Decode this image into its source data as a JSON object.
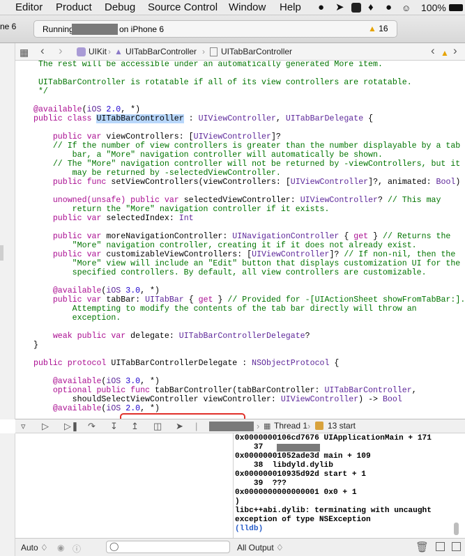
{
  "menubar": {
    "items": [
      "Editor",
      "Product",
      "Debug",
      "Source Control",
      "Window",
      "Help"
    ],
    "battery": "100%",
    "status_icons": [
      "qq-icon",
      "send-icon",
      "app-icon",
      "evernote-icon",
      "skype-icon",
      "menu-extra-icon",
      "wifi-icon",
      "battery-icon"
    ]
  },
  "toolbar": {
    "scheme_fragment": "ne 6",
    "status_running": "Running",
    "status_device": "on iPhone 6",
    "warning_count": "16"
  },
  "jumpbar": {
    "crumbs": [
      "UIKit",
      "UITabBarController",
      "UITabBarController"
    ]
  },
  "colors": {
    "keyword": "#aa0d91",
    "type": "#5c2699",
    "comment": "#007400",
    "number": "#1c00cf",
    "selection": "#b8d7fb",
    "callout": "#e0302a"
  },
  "code": {
    "lines": [
      [
        {
          "t": " The rest will be accessible under an automatically generated More item.",
          "c": "cm"
        }
      ],
      [],
      [
        {
          "t": " UITabBarController is rotatable if all of its view controllers are rotatable.",
          "c": "cm"
        }
      ],
      [
        {
          "t": " */",
          "c": "cm"
        }
      ],
      [],
      [
        {
          "t": "@available",
          "c": "kw"
        },
        {
          "t": "("
        },
        {
          "t": "iOS",
          "c": "ty"
        },
        {
          "t": " "
        },
        {
          "t": "2.0",
          "c": "nu"
        },
        {
          "t": ", *)"
        }
      ],
      [
        {
          "t": "public",
          "c": "kw"
        },
        {
          "t": " "
        },
        {
          "t": "class",
          "c": "kw"
        },
        {
          "t": " "
        },
        {
          "t": "UITabBarController",
          "c": "hl"
        },
        {
          "t": " : "
        },
        {
          "t": "UIViewController",
          "c": "ty"
        },
        {
          "t": ", "
        },
        {
          "t": "UITabBarDelegate",
          "c": "ty"
        },
        {
          "t": " {"
        }
      ],
      [],
      [
        {
          "t": "    "
        },
        {
          "t": "public",
          "c": "kw"
        },
        {
          "t": " "
        },
        {
          "t": "var",
          "c": "kw"
        },
        {
          "t": " viewControllers: ["
        },
        {
          "t": "UIViewController",
          "c": "ty"
        },
        {
          "t": "]?"
        }
      ],
      [
        {
          "t": "    // If the number of view controllers is greater than the number displayable by a tab",
          "c": "cm"
        }
      ],
      [
        {
          "t": "        bar, a \"More\" navigation controller will automatically be shown.",
          "c": "cm"
        }
      ],
      [
        {
          "t": "    // The \"More\" navigation controller will not be returned by -viewControllers, but it",
          "c": "cm"
        }
      ],
      [
        {
          "t": "        may be returned by -selectedViewController.",
          "c": "cm"
        }
      ],
      [
        {
          "t": "    "
        },
        {
          "t": "public",
          "c": "kw"
        },
        {
          "t": " "
        },
        {
          "t": "func",
          "c": "kw"
        },
        {
          "t": " setViewControllers(viewControllers: ["
        },
        {
          "t": "UIViewController",
          "c": "ty"
        },
        {
          "t": "]?, animated: "
        },
        {
          "t": "Bool",
          "c": "ty"
        },
        {
          "t": ")"
        }
      ],
      [],
      [
        {
          "t": "    "
        },
        {
          "t": "unowned(unsafe) public var",
          "c": "kw"
        },
        {
          "t": " selectedViewController: "
        },
        {
          "t": "UIViewController",
          "c": "ty"
        },
        {
          "t": "? "
        },
        {
          "t": "// This may",
          "c": "cm"
        }
      ],
      [
        {
          "t": "        return the \"More\" navigation controller if it exists.",
          "c": "cm"
        }
      ],
      [
        {
          "t": "    "
        },
        {
          "t": "public",
          "c": "kw"
        },
        {
          "t": " "
        },
        {
          "t": "var",
          "c": "kw"
        },
        {
          "t": " selectedIndex: "
        },
        {
          "t": "Int",
          "c": "ty"
        }
      ],
      [],
      [
        {
          "t": "    "
        },
        {
          "t": "public",
          "c": "kw"
        },
        {
          "t": " "
        },
        {
          "t": "var",
          "c": "kw"
        },
        {
          "t": " moreNavigationController: "
        },
        {
          "t": "UINavigationController",
          "c": "ty"
        },
        {
          "t": " { "
        },
        {
          "t": "get",
          "c": "kw"
        },
        {
          "t": " } "
        },
        {
          "t": "// Returns the",
          "c": "cm"
        }
      ],
      [
        {
          "t": "        \"More\" navigation controller, creating it if it does not already exist.",
          "c": "cm"
        }
      ],
      [
        {
          "t": "    "
        },
        {
          "t": "public",
          "c": "kw"
        },
        {
          "t": " "
        },
        {
          "t": "var",
          "c": "kw"
        },
        {
          "t": " customizableViewControllers: ["
        },
        {
          "t": "UIViewController",
          "c": "ty"
        },
        {
          "t": "]? "
        },
        {
          "t": "// If non-nil, then the",
          "c": "cm"
        }
      ],
      [
        {
          "t": "        \"More\" view will include an \"Edit\" button that displays customization UI for the",
          "c": "cm"
        }
      ],
      [
        {
          "t": "        specified controllers. By default, all view controllers are customizable.",
          "c": "cm"
        }
      ],
      [],
      [
        {
          "t": "    "
        },
        {
          "t": "@available",
          "c": "kw"
        },
        {
          "t": "("
        },
        {
          "t": "iOS",
          "c": "ty"
        },
        {
          "t": " "
        },
        {
          "t": "3.0",
          "c": "nu"
        },
        {
          "t": ", *)"
        }
      ],
      [
        {
          "t": "    "
        },
        {
          "t": "public",
          "c": "kw"
        },
        {
          "t": " "
        },
        {
          "t": "var",
          "c": "kw"
        },
        {
          "t": " tabBar: "
        },
        {
          "t": "UITabBar",
          "c": "ty"
        },
        {
          "t": " { "
        },
        {
          "t": "get",
          "c": "kw"
        },
        {
          "t": " } "
        },
        {
          "t": "// Provided for -[UIActionSheet showFromTabBar:].",
          "c": "cm"
        }
      ],
      [
        {
          "t": "        Attempting to modify the contents of the tab bar directly will throw an",
          "c": "cm"
        }
      ],
      [
        {
          "t": "        exception.",
          "c": "cm"
        }
      ],
      [],
      [
        {
          "t": "    "
        },
        {
          "t": "weak public var",
          "c": "kw"
        },
        {
          "t": " delegate: "
        },
        {
          "t": "UITabBarControllerDelegate",
          "c": "ty"
        },
        {
          "t": "?"
        }
      ],
      [
        {
          "t": "}"
        }
      ],
      [],
      [
        {
          "t": "public",
          "c": "kw"
        },
        {
          "t": " "
        },
        {
          "t": "protocol",
          "c": "kw"
        },
        {
          "t": " "
        },
        {
          "t": "UITabBarControllerDelegate"
        },
        {
          "t": " : "
        },
        {
          "t": "NSObjectProtocol",
          "c": "ty"
        },
        {
          "t": " {"
        }
      ],
      [],
      [
        {
          "t": "    "
        },
        {
          "t": "@available",
          "c": "kw"
        },
        {
          "t": "("
        },
        {
          "t": "iOS",
          "c": "ty"
        },
        {
          "t": " "
        },
        {
          "t": "3.0",
          "c": "nu"
        },
        {
          "t": ", *)"
        }
      ],
      [
        {
          "t": "    "
        },
        {
          "t": "optional public func",
          "c": "kw"
        },
        {
          "t": " tabBarController(tabBarController: "
        },
        {
          "t": "UITabBarController",
          "c": "ty"
        },
        {
          "t": ","
        }
      ],
      [
        {
          "t": "        shouldSelectViewController viewController: "
        },
        {
          "t": "UIViewController",
          "c": "ty"
        },
        {
          "t": ") -> "
        },
        {
          "t": "Bool",
          "c": "ty"
        }
      ],
      [
        {
          "t": "    "
        },
        {
          "t": "@available",
          "c": "kw"
        },
        {
          "t": "("
        },
        {
          "t": "iOS",
          "c": "ty"
        },
        {
          "t": " "
        },
        {
          "t": "2.0",
          "c": "nu"
        },
        {
          "t": ", *)"
        }
      ]
    ]
  },
  "debugbar": {
    "thread": "Thread 1",
    "frame": "13 start"
  },
  "console": {
    "lines": [
      "0x0000000106cd7676 UIApplicationMain + 171",
      "    37",
      "0x00000001052ade3d main + 109",
      "    38  libdyld.dylib",
      "0x000000010935d92d start + 1",
      "    39  ???",
      "0x0000000000000001 0x0 + 1",
      ")",
      "libc++abi.dylib: terminating with uncaught",
      "exception of type NSException",
      "(lldb)"
    ]
  },
  "bottombar": {
    "auto_label": "Auto ♢",
    "output_label": "All Output ♢"
  }
}
